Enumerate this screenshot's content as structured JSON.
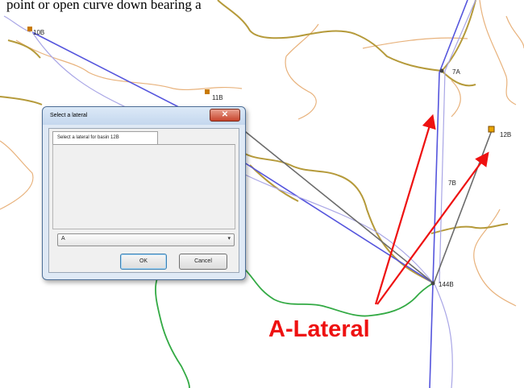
{
  "caption": "point or open curve down bearing a",
  "map": {
    "labels": {
      "node_10b": "10B",
      "node_11b": "11B",
      "node_7a": "7A",
      "node_12b": "12B",
      "node_7b": "7B",
      "node_144b": "144B"
    },
    "colors": {
      "contour": "#e8b27c",
      "road": "#b59a3a",
      "blue_line": "#5555dd",
      "light_blue_line": "#a9a6e6",
      "gray_line": "#6b6b6b",
      "green_line": "#33aa44",
      "arrow": "#ee1111",
      "node_marker": "#c87a00"
    }
  },
  "annotation": {
    "text": "A-Lateral"
  },
  "dialog": {
    "title": "Select a lateral",
    "close_label": "✕",
    "tab_label": "Select a lateral for basin 12B",
    "select_value": "A",
    "select_arrow": "▾",
    "ok_label": "OK",
    "cancel_label": "Cancel"
  }
}
